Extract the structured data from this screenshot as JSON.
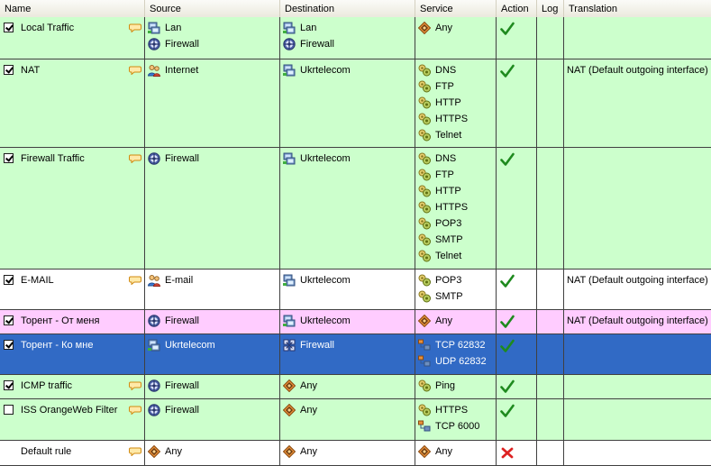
{
  "columns": [
    "Name",
    "Source",
    "Destination",
    "Service",
    "Action",
    "Log",
    "Translation"
  ],
  "rows": [
    {
      "id": "local-traffic",
      "checked": true,
      "name": "Local Traffic",
      "note": true,
      "bg": "#ccffcc",
      "source": [
        {
          "icon": "network",
          "label": "Lan"
        },
        {
          "icon": "firewall",
          "label": "Firewall"
        }
      ],
      "destination": [
        {
          "icon": "network",
          "label": "Lan"
        },
        {
          "icon": "firewall",
          "label": "Firewall"
        }
      ],
      "service": [
        {
          "icon": "any",
          "label": "Any"
        }
      ],
      "action": "allow",
      "translation": ""
    },
    {
      "id": "nat",
      "checked": true,
      "name": "NAT",
      "note": true,
      "bg": "#ccffcc",
      "source": [
        {
          "icon": "users",
          "label": "Internet"
        }
      ],
      "destination": [
        {
          "icon": "network",
          "label": "Ukrtelecom"
        }
      ],
      "service": [
        {
          "icon": "protocol",
          "label": "DNS"
        },
        {
          "icon": "protocol",
          "label": "FTP"
        },
        {
          "icon": "protocol",
          "label": "HTTP"
        },
        {
          "icon": "protocol",
          "label": "HTTPS"
        },
        {
          "icon": "protocol",
          "label": "Telnet"
        }
      ],
      "action": "allow",
      "translation": "NAT (Default outgoing interface)"
    },
    {
      "id": "firewall-traffic",
      "checked": true,
      "name": "Firewall Traffic",
      "note": true,
      "bg": "#ccffcc",
      "source": [
        {
          "icon": "firewall",
          "label": "Firewall"
        }
      ],
      "destination": [
        {
          "icon": "network",
          "label": "Ukrtelecom"
        }
      ],
      "service": [
        {
          "icon": "protocol",
          "label": "DNS"
        },
        {
          "icon": "protocol",
          "label": "FTP"
        },
        {
          "icon": "protocol",
          "label": "HTTP"
        },
        {
          "icon": "protocol",
          "label": "HTTPS"
        },
        {
          "icon": "protocol",
          "label": "POP3"
        },
        {
          "icon": "protocol",
          "label": "SMTP"
        },
        {
          "icon": "protocol",
          "label": "Telnet"
        }
      ],
      "action": "allow",
      "translation": ""
    },
    {
      "id": "e-mail",
      "checked": true,
      "name": "E-MAIL",
      "note": true,
      "bg": "#ffffff",
      "source": [
        {
          "icon": "users",
          "label": "E-mail"
        }
      ],
      "destination": [
        {
          "icon": "network",
          "label": "Ukrtelecom"
        }
      ],
      "service": [
        {
          "icon": "protocol",
          "label": "POP3"
        },
        {
          "icon": "protocol",
          "label": "SMTP"
        }
      ],
      "action": "allow",
      "translation": "NAT (Default outgoing interface)"
    },
    {
      "id": "torrent-from-me",
      "checked": true,
      "name": "Торент - От меня",
      "note": false,
      "bg": "#ffccff",
      "source": [
        {
          "icon": "firewall",
          "label": "Firewall"
        }
      ],
      "destination": [
        {
          "icon": "network",
          "label": "Ukrtelecom"
        }
      ],
      "service": [
        {
          "icon": "any",
          "label": "Any"
        }
      ],
      "action": "allow",
      "translation": "NAT (Default outgoing interface)"
    },
    {
      "id": "torrent-to-me",
      "checked": true,
      "name": "Торент - Ко мне",
      "note": false,
      "bg": "#316ac5",
      "selected": true,
      "source": [
        {
          "icon": "network",
          "label": "Ukrtelecom"
        }
      ],
      "destination": [
        {
          "icon": "firewall-grid",
          "label": "Firewall"
        }
      ],
      "service": [
        {
          "icon": "port",
          "label": "TCP 62832"
        },
        {
          "icon": "port",
          "label": "UDP 62832"
        }
      ],
      "action": "allow",
      "translation": ""
    },
    {
      "id": "icmp-traffic",
      "checked": true,
      "name": "ICMP traffic",
      "note": true,
      "bg": "#ccffcc",
      "source": [
        {
          "icon": "firewall",
          "label": "Firewall"
        }
      ],
      "destination": [
        {
          "icon": "any",
          "label": "Any"
        }
      ],
      "service": [
        {
          "icon": "protocol",
          "label": "Ping"
        }
      ],
      "action": "allow",
      "translation": ""
    },
    {
      "id": "iss-orangeweb-filter",
      "checked": false,
      "name": "ISS OrangeWeb Filter",
      "note": true,
      "bg": "#ccffcc",
      "source": [
        {
          "icon": "firewall",
          "label": "Firewall"
        }
      ],
      "destination": [
        {
          "icon": "any",
          "label": "Any"
        }
      ],
      "service": [
        {
          "icon": "protocol",
          "label": "HTTPS"
        },
        {
          "icon": "port",
          "label": "TCP 6000"
        }
      ],
      "action": "allow",
      "translation": ""
    },
    {
      "id": "default-rule",
      "checked": null,
      "name": "Default rule",
      "note": true,
      "bg": "#ffffff",
      "source": [
        {
          "icon": "any",
          "label": "Any"
        }
      ],
      "destination": [
        {
          "icon": "any",
          "label": "Any"
        }
      ],
      "service": [
        {
          "icon": "any",
          "label": "Any"
        }
      ],
      "action": "block",
      "translation": ""
    }
  ]
}
